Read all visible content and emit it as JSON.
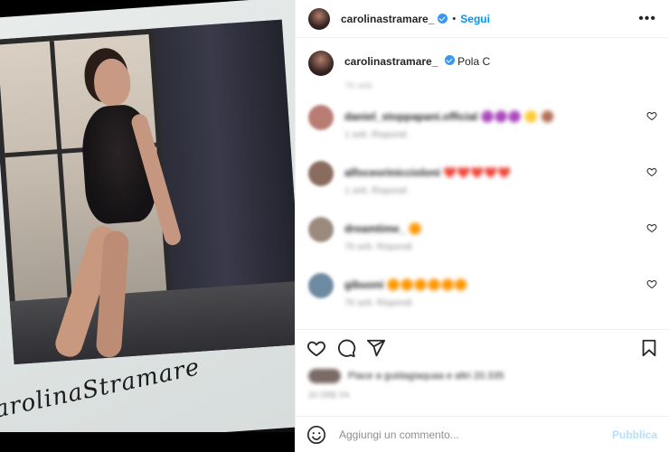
{
  "post": {
    "username": "carolinastramare_",
    "follow_separator": "•",
    "follow_label": "Segui",
    "more_icon": "more-horizontal-icon",
    "caption_text": "Pola C",
    "caption_time": "76 sett."
  },
  "media": {
    "signature": "CarolinaStramare"
  },
  "comments": [
    {
      "user": "daniel_stoppapani.official",
      "text": "🟣🟣🟣 🟡 🟤",
      "meta": "1 sett.    Rispondi",
      "avatar_color": "#b97c72"
    },
    {
      "user": "alfoceoriniccioloni",
      "text": "❤️❤️❤️❤️❤️",
      "meta": "1 sett.    Rispondi",
      "avatar_color": "#8a6c5e"
    },
    {
      "user": "dreamtime_",
      "text": "🟠",
      "meta": "76 sett.    Rispondi",
      "avatar_color": "#9a8a7e"
    },
    {
      "user": "gibuoni",
      "text": "🟠🟠🟠🟠🟠🟠",
      "meta": "76 sett.    Rispondi",
      "avatar_color": "#6e8aa3"
    }
  ],
  "likes": {
    "text": "Piace a guidagiaquaa e altri 20.335"
  },
  "date": "20 ORE FA",
  "add_comment": {
    "emoji_icon": "smiley-icon",
    "placeholder": "Aggiungi un commento...",
    "publish_label": "Pubblica"
  },
  "colors": {
    "accent": "#0095f6",
    "publish_disabled": "#b2dffc",
    "verified": "#3897f0"
  }
}
